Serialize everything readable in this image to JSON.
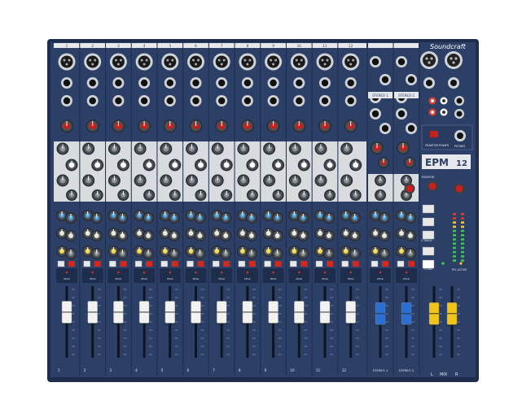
{
  "brand": {
    "logo_text": "Soundcraft",
    "model": "EPM",
    "model_suffix": "12"
  },
  "colors": {
    "panel": "#2c3f66",
    "panel_dark": "#1f2d4c",
    "panel_light": "#3a507d",
    "eq_strip": "#d9dcdf",
    "knob_red": "#c8201c",
    "knob_gray": "#8c9196",
    "knob_dark": "#3b3f46",
    "fader_white": "#f2f2f2",
    "fader_blue": "#2c6fd4",
    "fader_yellow": "#f0c419",
    "mute_red": "#d02a20",
    "meter_green": "#39c84a"
  },
  "channels": {
    "numbers": [
      "1",
      "2",
      "3",
      "4",
      "5",
      "6",
      "7",
      "8",
      "9",
      "10",
      "11",
      "12"
    ],
    "labels": [
      "1",
      "2",
      "3",
      "4",
      "5",
      "6",
      "7",
      "8",
      "9",
      "10",
      "11",
      "12"
    ],
    "peak_label": "PEAK",
    "pfl_label": "PFL",
    "mute_label": "MUTE",
    "fader_levels": [
      0.62,
      0.62,
      0.62,
      0.62,
      0.62,
      0.62,
      0.62,
      0.62,
      0.62,
      0.62,
      0.62,
      0.62
    ]
  },
  "stereo_channels": {
    "labels": [
      "STEREO 1",
      "STEREO 2"
    ],
    "fader_levels": [
      0.6,
      0.6
    ]
  },
  "master": {
    "label_l": "L",
    "label_mix": "MIX",
    "label_r": "R",
    "fader_levels": [
      0.6,
      0.6
    ],
    "phantom_power": "PHANTOM POWER",
    "phones": "PHONES",
    "monitor": "MONITOR",
    "two_track": "2 TRACK",
    "to_mix": "TO MIX",
    "pfl_active": "PFL ACTIVE"
  }
}
